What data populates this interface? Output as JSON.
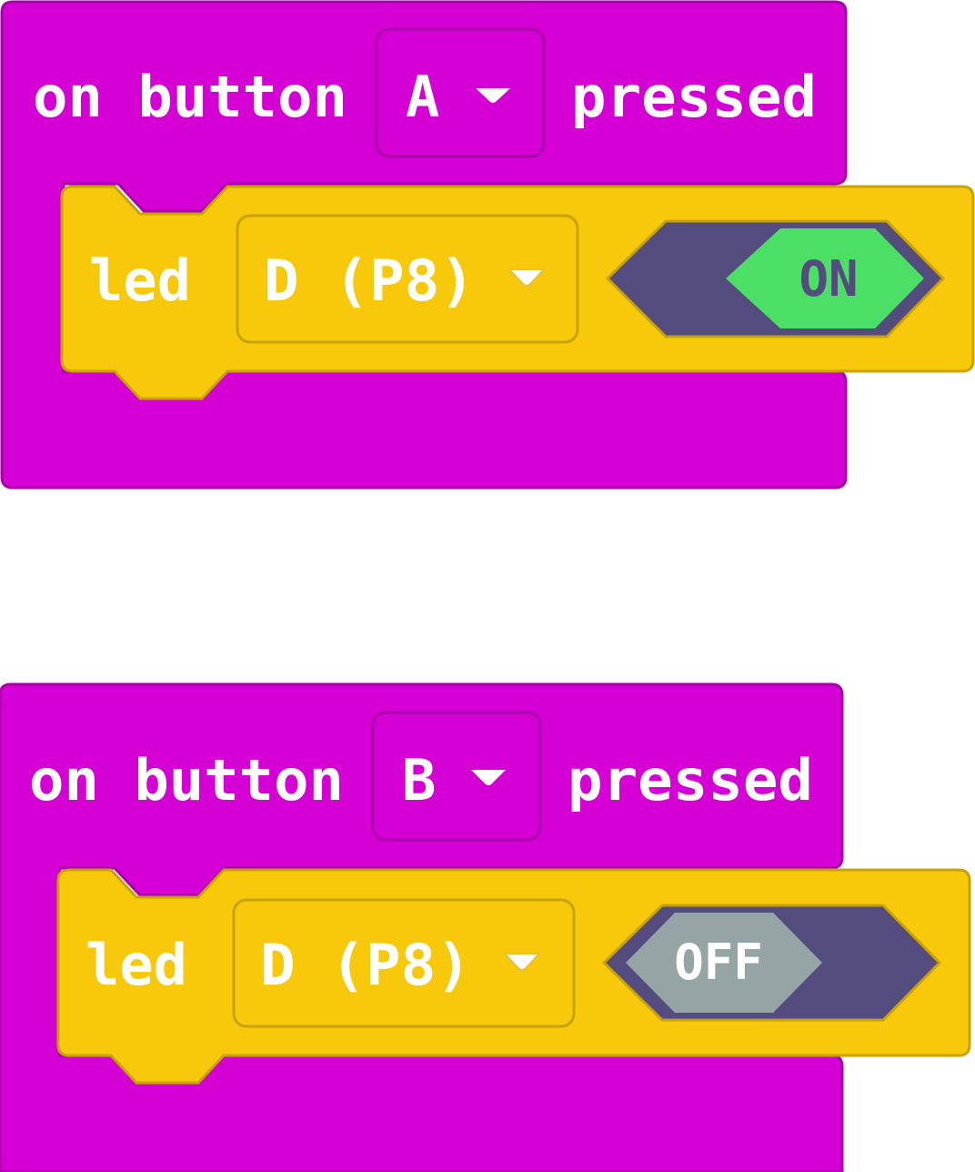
{
  "colors": {
    "event_block": "#d400d4",
    "event_border": "#aa00aa",
    "statement_block": "#f7c90a",
    "statement_border": "#c8a206",
    "toggle_track": "#544b7e",
    "toggle_on": "#4cdf65",
    "toggle_off": "#95a5a6",
    "text": "#ffffff"
  },
  "blocks": [
    {
      "event_prefix": "on button",
      "button": "A",
      "event_suffix": "pressed",
      "statement_label": "led",
      "pin": "D (P8)",
      "state": "ON",
      "state_on": true
    },
    {
      "event_prefix": "on button",
      "button": "B",
      "event_suffix": "pressed",
      "statement_label": "led",
      "pin": "D (P8)",
      "state": "OFF",
      "state_on": false
    }
  ]
}
